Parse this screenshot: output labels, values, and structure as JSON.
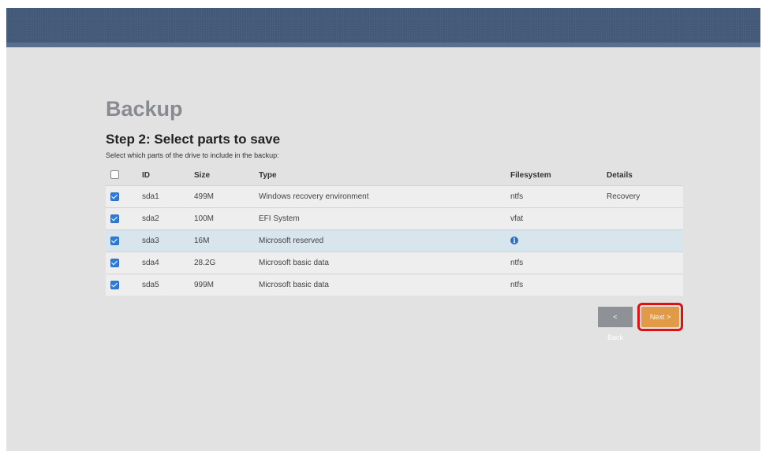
{
  "header": {},
  "page": {
    "title": "Backup",
    "step_title": "Step 2: Select parts to save",
    "hint": "Select which parts of the drive to include in the backup:"
  },
  "table": {
    "columns": [
      "ID",
      "Size",
      "Type",
      "Filesystem",
      "Details"
    ],
    "select_all_checked": false,
    "rows": [
      {
        "checked": true,
        "id": "sda1",
        "size": "499M",
        "type": "Windows recovery environment",
        "filesystem": "ntfs",
        "details": "Recovery"
      },
      {
        "checked": true,
        "id": "sda2",
        "size": "100M",
        "type": "EFI System",
        "filesystem": "vfat",
        "details": ""
      },
      {
        "checked": true,
        "id": "sda3",
        "size": "16M",
        "type": "Microsoft reserved",
        "filesystem": "",
        "filesystem_icon": "info-icon",
        "details": ""
      },
      {
        "checked": true,
        "id": "sda4",
        "size": "28.2G",
        "type": "Microsoft basic data",
        "filesystem": "ntfs",
        "details": ""
      },
      {
        "checked": true,
        "id": "sda5",
        "size": "999M",
        "type": "Microsoft basic data",
        "filesystem": "ntfs",
        "details": ""
      }
    ]
  },
  "buttons": {
    "back_label": "< Back",
    "next_label": "Next >"
  },
  "colors": {
    "topbar": "#415876",
    "accent_next": "#e19a47",
    "checkbox": "#2f7bd8",
    "highlight_border": "#e01010"
  }
}
